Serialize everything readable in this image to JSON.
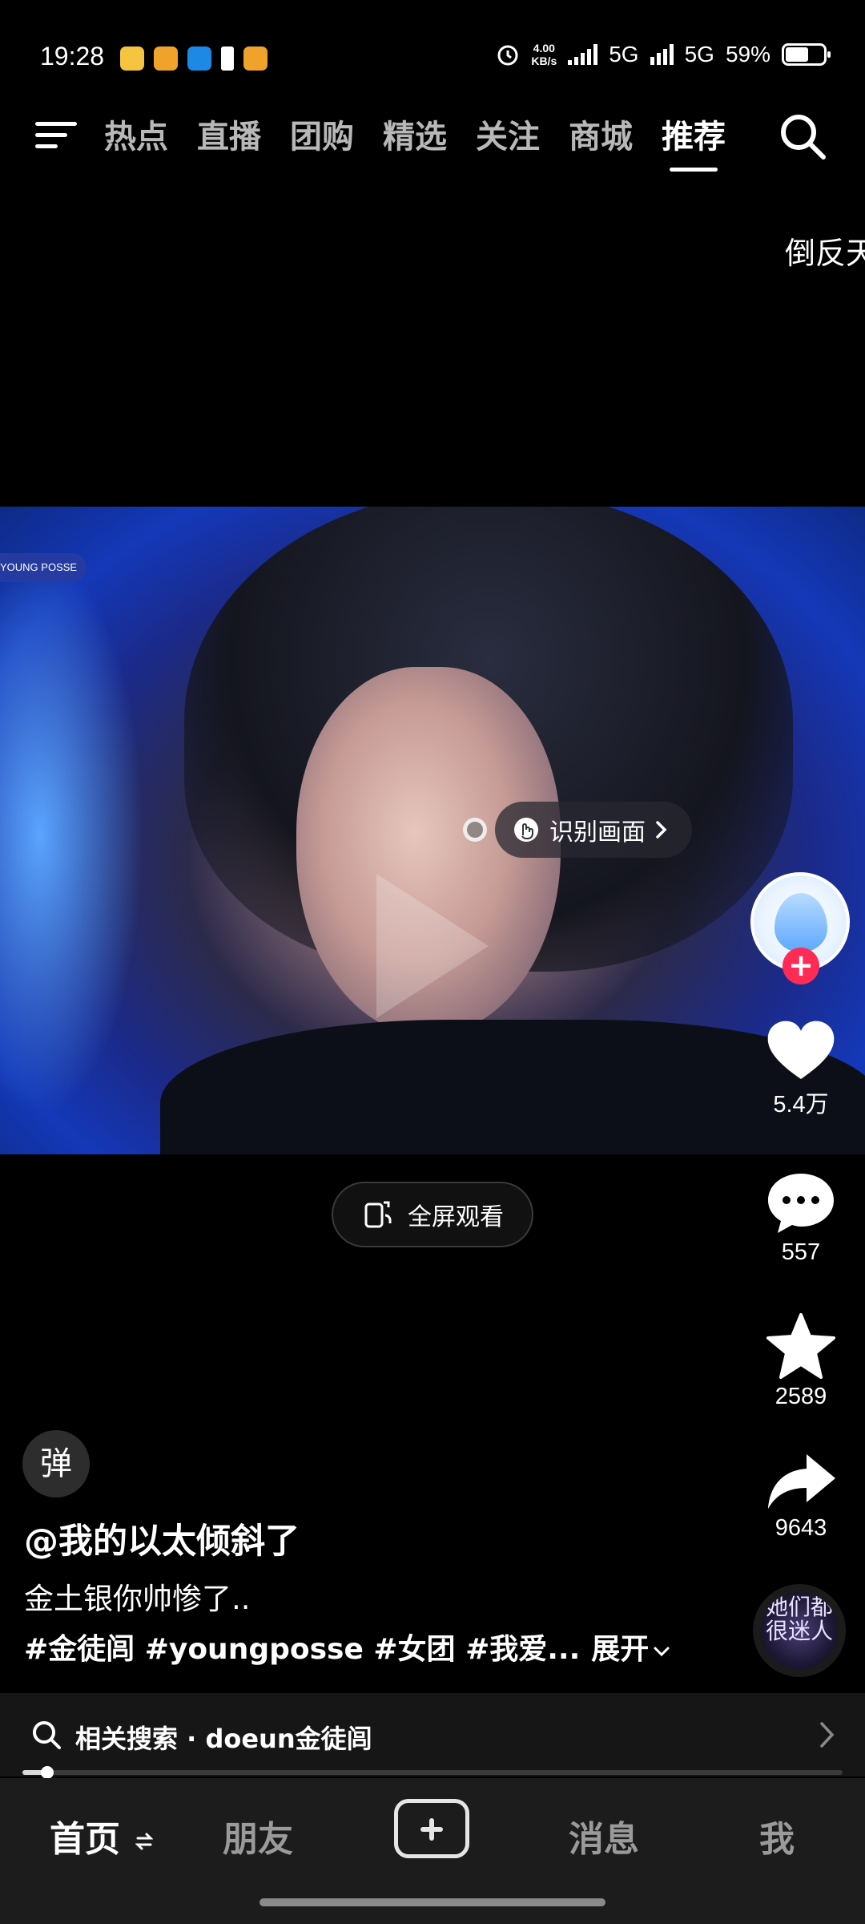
{
  "status_bar": {
    "time": "19:28",
    "net_speed_value": "4.00",
    "net_speed_unit": "KB/s",
    "signal1_label": "5G",
    "signal2_label": "5G",
    "battery": "59%",
    "app_icons": [
      {
        "name": "fruit-app-icon",
        "color": "#f5c542"
      },
      {
        "name": "weibo-icon",
        "color": "#f0a32b"
      },
      {
        "name": "zhihu-icon",
        "color": "#1e88e5"
      },
      {
        "name": "notification-icon",
        "color": "#ffffff"
      },
      {
        "name": "weibo-icon",
        "color": "#f0a32b"
      }
    ]
  },
  "top_nav": {
    "tabs": [
      {
        "label": "热点",
        "active": false
      },
      {
        "label": "直播",
        "active": false
      },
      {
        "label": "团购",
        "active": false
      },
      {
        "label": "精选",
        "active": false
      },
      {
        "label": "关注",
        "active": false
      },
      {
        "label": "商城",
        "active": false
      },
      {
        "label": "推荐",
        "active": true
      }
    ]
  },
  "floating_text": "倒反天",
  "video": {
    "badge_text": "YOUNG POSSE",
    "recognize_label": "识别画面",
    "fullscreen_label": "全屏观看"
  },
  "actions": {
    "likes": "5.4万",
    "comments": "557",
    "favorites": "2589",
    "shares": "9643",
    "music_disc_text": "她们都很迷人"
  },
  "caption": {
    "danmu_label": "弹",
    "author": "@我的以太倾斜了",
    "description": "金土银你帅惨了..",
    "tags": "#金徒闾 #youngposse #女团 #我爱...",
    "expand_label": "展开"
  },
  "related_search": {
    "prefix": "相关搜索",
    "separator": " · ",
    "query": "doeun金徒闾"
  },
  "playback": {
    "progress_fraction": 0.03
  },
  "bottom_nav": {
    "home": "首页",
    "friends": "朋友",
    "messages": "消息",
    "me": "我"
  },
  "colors": {
    "accent": "#fe2c55",
    "background": "#000000",
    "bottom_bar": "#1c1c1c"
  }
}
